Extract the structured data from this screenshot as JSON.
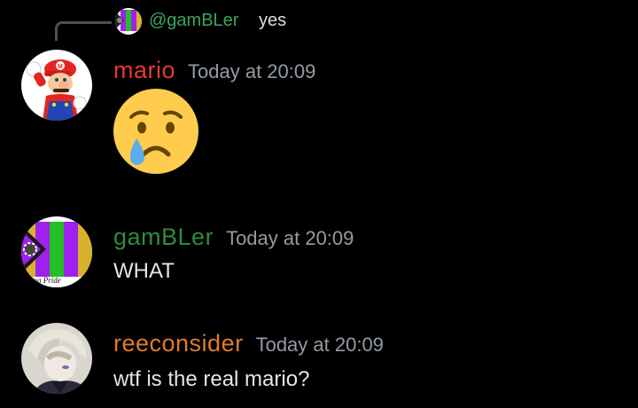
{
  "reply": {
    "author": "@gamBLer",
    "text": "yes",
    "author_color": "#3ba55c"
  },
  "messages": [
    {
      "username": "mario",
      "timestamp": "Today at 20:09",
      "content": "",
      "emoji": "crying-face",
      "name_color": "#e53935"
    },
    {
      "username": "gamBLer",
      "timestamp": "Today at 20:09",
      "content": "WHAT",
      "name_color": "#2e8b3e",
      "avatar_caption": "bling Pride"
    },
    {
      "username": "reeconsider",
      "timestamp": "Today at 20:09",
      "content": "wtf is the real mario?",
      "name_color": "#e07b2a"
    }
  ],
  "colors": {
    "background": "#000000",
    "timestamp": "#949ba4",
    "text": "#e3e5e8"
  },
  "icons": [
    "reply-connector",
    "crying-face-emoji",
    "gambling-pride-flag-avatar",
    "mario-avatar",
    "anime-avatar"
  ]
}
